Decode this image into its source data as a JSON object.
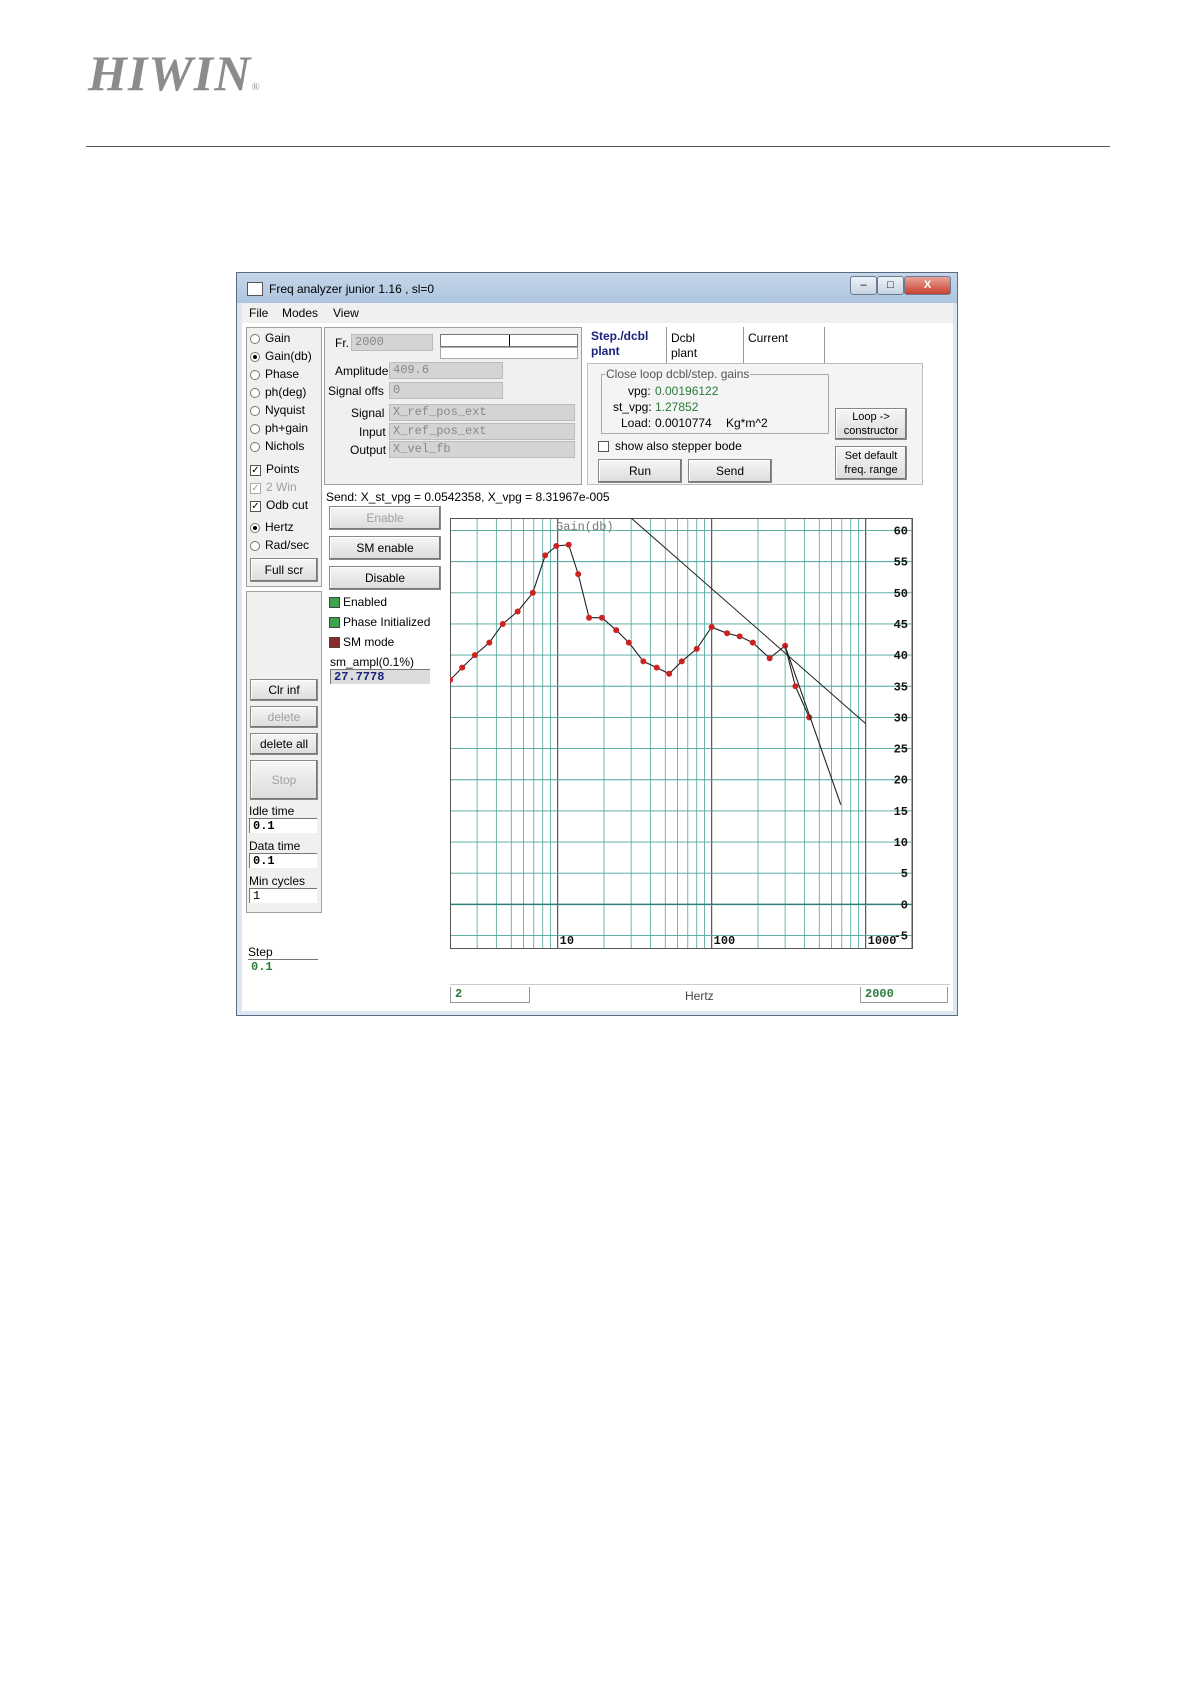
{
  "logo": {
    "text": "HIWIN",
    "mark": "®"
  },
  "window": {
    "title": "Freq analyzer junior 1.16 , sl=0",
    "controls": {
      "minimize": "‒",
      "maximize": "□",
      "close": "X"
    }
  },
  "menu": [
    "File",
    "Modes",
    "View"
  ],
  "left_panel": {
    "modes": [
      {
        "label": "Gain",
        "selected": false
      },
      {
        "label": "Gain(db)",
        "selected": true
      },
      {
        "label": "Phase",
        "selected": false
      },
      {
        "label": "ph(deg)",
        "selected": false
      },
      {
        "label": "Nyquist",
        "selected": false
      },
      {
        "label": "ph+gain",
        "selected": false
      },
      {
        "label": "Nichols",
        "selected": false
      }
    ],
    "checks": [
      {
        "label": "Points",
        "checked": true,
        "enabled": true
      },
      {
        "label": "2 Win",
        "checked": true,
        "enabled": false
      },
      {
        "label": "Odb cut",
        "checked": true,
        "enabled": true
      }
    ],
    "units": [
      {
        "label": "Hertz",
        "selected": true
      },
      {
        "label": "Rad/sec",
        "selected": false
      }
    ],
    "full_scr": "Full scr",
    "clr_inf": "Clr inf",
    "delete": "delete",
    "delete_all": "delete all",
    "stop": "Stop",
    "idle_time_label": "Idle time",
    "idle_time": "0.1",
    "data_time_label": "Data time",
    "data_time": "0.1",
    "min_cycles_label": "Min cycles",
    "min_cycles": "1",
    "step_label": "Step",
    "step": "0.1"
  },
  "signal_panel": {
    "fr_label": "Fr.",
    "fr": "2000",
    "amplitude_label": "Amplitude",
    "amplitude": "409.6",
    "signal_offs_label": "Signal offs",
    "signal_offs": "0",
    "signal_label": "Signal",
    "signal": "X_ref_pos_ext",
    "input_label": "Input",
    "input": "X_ref_pos_ext",
    "output_label": "Output",
    "output": "X_vel_fb"
  },
  "tabs": [
    {
      "label": "Step./dcbl plant",
      "active": true
    },
    {
      "label": "Dcbl plant",
      "active": false
    },
    {
      "label": "Current",
      "active": false
    }
  ],
  "gains": {
    "group_title": "Close loop dcbl/step. gains",
    "vpg_label": "vpg:",
    "vpg": "0.00196122",
    "st_vpg_label": "st_vpg:",
    "st_vpg": "1.27852",
    "load_label": "Load:",
    "load": "0.0010774",
    "load_unit": "Kg*m^2",
    "stepper_bode_label": "show also stepper bode",
    "stepper_bode_checked": false,
    "run": "Run",
    "send": "Send",
    "loop_constructor_1": "Loop ->",
    "loop_constructor_2": "constructor",
    "set_default_1": "Set default",
    "set_default_2": "freq. range"
  },
  "send_status": "Send: X_st_vpg = 0.0542358, X_vpg = 8.31967e-005",
  "drive_panel": {
    "enable": "Enable",
    "sm_enable": "SM enable",
    "disable": "Disable",
    "enabled_label": "Enabled",
    "phase_init_label": "Phase Initialized",
    "sm_mode_label": "SM mode",
    "sm_ampl_label": "sm_ampl(0.1%)",
    "sm_ampl": "27.7778",
    "colors": {
      "green_led": "#3fa34d",
      "red_led": "#8b2b2b"
    }
  },
  "chart_data": {
    "type": "line",
    "title": "Gain(db)",
    "xlabel": "Hertz",
    "xscale": "log",
    "xlim": [
      2,
      2000
    ],
    "ylim": [
      -7,
      62
    ],
    "xtick_labels": [
      "10",
      "100",
      "1000"
    ],
    "ytick_labels": [
      "60",
      "55",
      "50",
      "45",
      "40",
      "35",
      "30",
      "25",
      "20",
      "15",
      "10",
      "5",
      "0",
      "-5"
    ],
    "x_start_label": "2",
    "x_end_label": "2000",
    "grid": true,
    "series": [
      {
        "points": [
          [
            2,
            36
          ],
          [
            2.4,
            38
          ],
          [
            2.9,
            40
          ],
          [
            3.6,
            42
          ],
          [
            4.4,
            45
          ],
          [
            5.5,
            47
          ],
          [
            6.9,
            50
          ],
          [
            8.3,
            56
          ],
          [
            9.8,
            57.5
          ],
          [
            11.8,
            57.7
          ],
          [
            13.6,
            53
          ],
          [
            16,
            46
          ],
          [
            19.4,
            46
          ],
          [
            24,
            44
          ],
          [
            29,
            42
          ],
          [
            36,
            39
          ],
          [
            44,
            38
          ],
          [
            53,
            37
          ],
          [
            64,
            39
          ],
          [
            80,
            41
          ],
          [
            100,
            44.5
          ],
          [
            126,
            43.5
          ],
          [
            152,
            43
          ],
          [
            185,
            42
          ],
          [
            238,
            39.5
          ],
          [
            300,
            41.5
          ],
          [
            350,
            35
          ],
          [
            430,
            30
          ]
        ]
      },
      {
        "points": [
          [
            300,
            41.5
          ],
          [
            690,
            16
          ]
        ]
      }
    ],
    "reference_line": [
      [
        30,
        62
      ],
      [
        1000,
        29
      ]
    ],
    "colors": {
      "curve": "#222222",
      "points": "#cc2222",
      "grid": "#4aa59a",
      "ref": "#222222"
    }
  }
}
